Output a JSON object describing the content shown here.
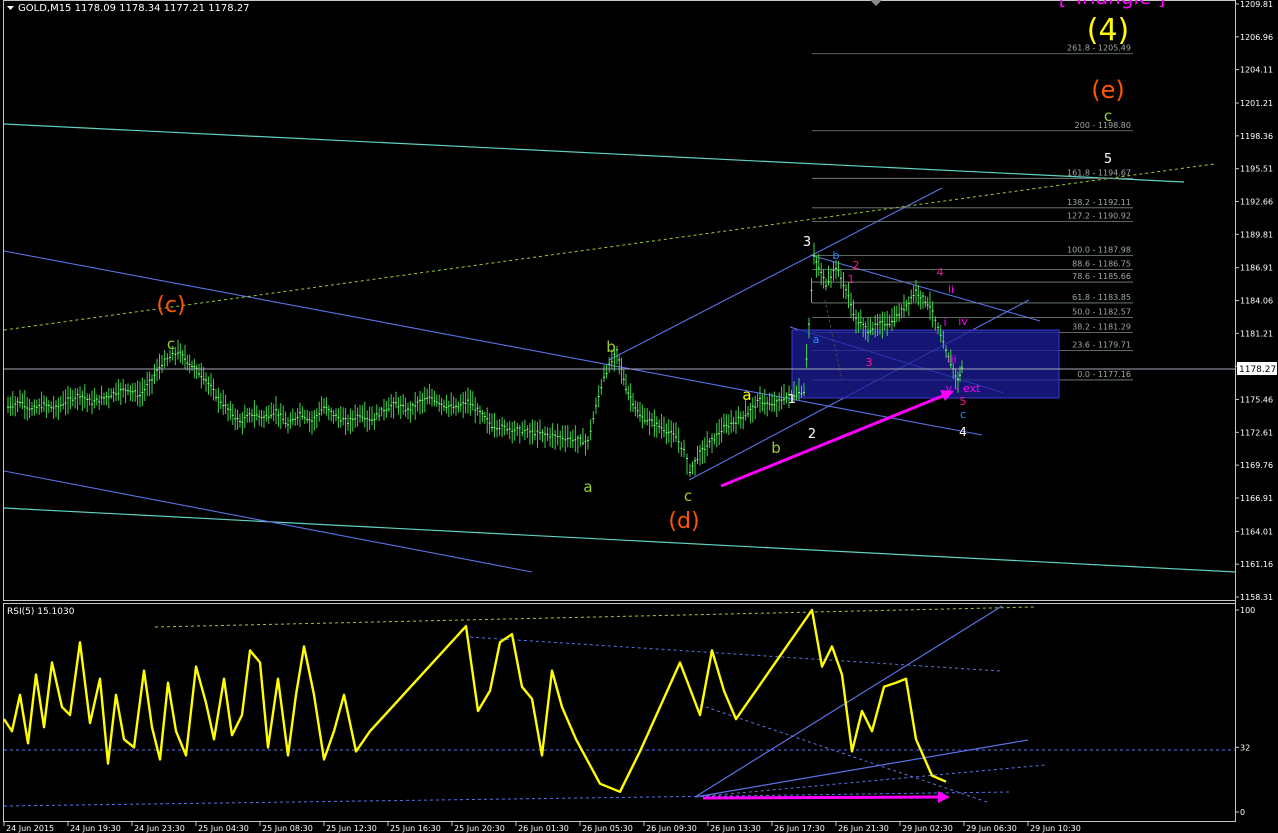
{
  "main": {
    "symbol_info": "GOLD,M15  1178.09 1178.34 1177.21 1178.27",
    "current_price": "1178.27",
    "price_ticks": [
      "1209.81",
      "1206.96",
      "1204.11",
      "1201.21",
      "1198.36",
      "1195.51",
      "1192.66",
      "1189.81",
      "1186.91",
      "1184.06",
      "1181.21",
      "1178.36",
      "1175.46",
      "1172.61",
      "1169.76",
      "1166.91",
      "1164.01",
      "1161.16",
      "1158.31"
    ]
  },
  "rsi": {
    "label": "RSI(5) 15.1030",
    "ticks": [
      "100",
      "32",
      "0"
    ]
  },
  "time_ticks": [
    "24 Jun 2015",
    "24 Jun 19:30",
    "24 Jun 23:30",
    "25 Jun 04:30",
    "25 Jun 08:30",
    "25 Jun 12:30",
    "25 Jun 16:30",
    "25 Jun 20:30",
    "26 Jun 01:30",
    "26 Jun 05:30",
    "26 Jun 09:30",
    "26 Jun 13:30",
    "26 Jun 17:30",
    "26 Jun 21:30",
    "29 Jun 02:30",
    "29 Jun 06:30",
    "29 Jun 10:30"
  ],
  "fib_levels": [
    {
      "ratio": "261.8",
      "price": "1205.49"
    },
    {
      "ratio": "200",
      "price": "1198.80"
    },
    {
      "ratio": "161.8",
      "price": "1194.67"
    },
    {
      "ratio": "138.2",
      "price": "1192.11"
    },
    {
      "ratio": "127.2",
      "price": "1190.92"
    },
    {
      "ratio": "100.0",
      "price": "1187.98"
    },
    {
      "ratio": "88.6",
      "price": "1186.75"
    },
    {
      "ratio": "78.6",
      "price": "1185.66"
    },
    {
      "ratio": "61.8",
      "price": "1183.85"
    },
    {
      "ratio": "50.0",
      "price": "1182.57"
    },
    {
      "ratio": "38.2",
      "price": "1181.29"
    },
    {
      "ratio": "23.6",
      "price": "1179.71"
    },
    {
      "ratio": "0.0",
      "price": "1177.16"
    }
  ],
  "wave_labels": [
    {
      "text": "[ Triangle ]",
      "color": "#ff00ff",
      "size": 20
    },
    {
      "text": "(4)",
      "color": "#ffff00",
      "size": 30
    },
    {
      "text": "(e)",
      "color": "#ff5500",
      "size": 24
    },
    {
      "text": "c",
      "color": "#9acd32",
      "size": 15
    },
    {
      "text": "5",
      "color": "#ffffff",
      "size": 13
    },
    {
      "text": "(c)",
      "color": "#ff5500",
      "size": 22
    },
    {
      "text": "c",
      "color": "#9acd32",
      "size": 15
    },
    {
      "text": "b",
      "color": "#9acd32",
      "size": 15
    },
    {
      "text": "a",
      "color": "#9acd32",
      "size": 15
    },
    {
      "text": "c",
      "color": "#9acd32",
      "size": 15
    },
    {
      "text": "(d)",
      "color": "#ff5500",
      "size": 22
    },
    {
      "text": "a",
      "color": "#ffff00",
      "size": 15
    },
    {
      "text": "b",
      "color": "#9acd32",
      "size": 15
    },
    {
      "text": "1",
      "color": "#ffffff",
      "size": 12
    },
    {
      "text": "2",
      "color": "#ffffff",
      "size": 13
    },
    {
      "text": "3",
      "color": "#ffffff",
      "size": 13
    },
    {
      "text": "a",
      "color": "#1e90ff",
      "size": 11
    },
    {
      "text": "b",
      "color": "#1e90ff",
      "size": 11
    },
    {
      "text": "2",
      "color": "#ff1493",
      "size": 11
    },
    {
      "text": "1",
      "color": "#ff1493",
      "size": 11
    },
    {
      "text": "3",
      "color": "#ff1493",
      "size": 11
    },
    {
      "text": "4",
      "color": "#ff1493",
      "size": 11
    },
    {
      "text": "ii",
      "color": "#ff00ff",
      "size": 11
    },
    {
      "text": "i",
      "color": "#ff00ff",
      "size": 11
    },
    {
      "text": "iv",
      "color": "#ff00ff",
      "size": 11
    },
    {
      "text": "iii",
      "color": "#ff00ff",
      "size": 11
    },
    {
      "text": "v - ext",
      "color": "#ff00ff",
      "size": 11
    },
    {
      "text": "5",
      "color": "#ff1493",
      "size": 11
    },
    {
      "text": "c",
      "color": "#1e90ff",
      "size": 11
    },
    {
      "text": "4",
      "color": "#ffffff",
      "size": 12
    }
  ],
  "chart_data": [
    {
      "type": "line",
      "title": "GOLD,M15",
      "series": [
        {
          "values": [
            1174.8,
            1175.3,
            1174.6,
            1175.0,
            1174.7,
            1175.4,
            1175.9,
            1175.2,
            1175.6,
            1176.1,
            1176.4,
            1175.8,
            1177.2,
            1178.6,
            1179.6,
            1178.4,
            1177.2,
            1175.8,
            1174.6,
            1173.5,
            1174.2,
            1173.9,
            1174.5,
            1173.2,
            1174.3,
            1173.6,
            1174.8,
            1174.0,
            1173.5,
            1174.2,
            1173.7,
            1174.6,
            1175.1,
            1174.5,
            1175.3,
            1175.6,
            1175.0,
            1174.7,
            1175.3,
            1174.3,
            1173.2,
            1171.8,
            1174.8,
            1177.5,
            1179.6,
            1176.5,
            1174.0,
            1173.5,
            1172.9,
            1172.2,
            1171.0,
            1169.3,
            1170.8,
            1171.9,
            1173.0,
            1173.6,
            1174.3,
            1175.4,
            1174.9,
            1175.6,
            1176.2,
            1187.8,
            1185.5,
            1187.0,
            1185.0,
            1182.4,
            1181.5,
            1182.0,
            1182.2,
            1183.4,
            1184.9,
            1183.6,
            1179.6,
            1177.1,
            1178.2
          ]
        }
      ],
      "ylim": [
        1158.31,
        1209.81
      ]
    },
    {
      "type": "line",
      "title": "RSI(5) 15.1030",
      "series": [
        {
          "values": [
            46,
            40,
            58,
            34,
            68,
            42,
            74,
            52,
            48,
            84,
            44,
            66,
            24,
            58,
            36,
            32,
            70,
            42,
            26,
            64,
            40,
            28,
            72,
            54,
            36,
            66,
            38,
            48,
            80,
            74,
            32,
            66,
            28,
            58,
            82,
            58,
            26,
            40,
            58,
            30,
            40,
            92,
            50,
            60,
            84,
            88,
            62,
            56,
            28,
            70,
            52,
            36,
            14,
            10,
            30,
            52,
            74,
            48,
            80,
            60,
            46,
            100,
            72,
            82,
            68,
            30,
            50,
            40,
            62,
            64,
            66,
            36,
            18,
            15
          ]
        }
      ],
      "ylim": [
        0,
        100
      ]
    }
  ]
}
